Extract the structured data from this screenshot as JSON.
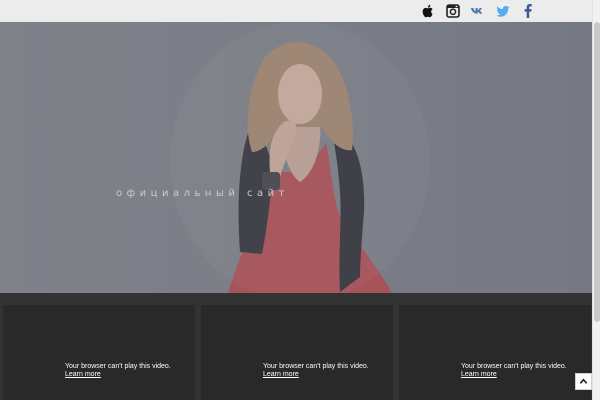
{
  "header": {
    "social": [
      {
        "name": "apple-icon",
        "color": "#111111"
      },
      {
        "name": "instagram-icon",
        "color": "#222222"
      },
      {
        "name": "vk-icon",
        "color": "#4a76a8"
      },
      {
        "name": "twitter-icon",
        "color": "#55acee"
      },
      {
        "name": "facebook-icon",
        "color": "#3b5998"
      }
    ]
  },
  "hero": {
    "tagline": "официальный сайт"
  },
  "videos": [
    {
      "message": "Your browser can't play this video.",
      "link": "Learn more"
    },
    {
      "message": "Your browser can't play this video.",
      "link": "Learn more"
    },
    {
      "message": "Your browser can't play this video.",
      "link": "Learn more"
    }
  ],
  "back_to_top": {
    "icon": "chevron-up-icon"
  }
}
